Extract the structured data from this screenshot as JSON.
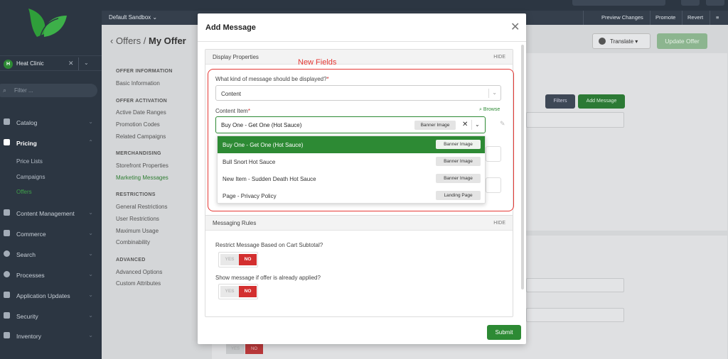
{
  "sidebar": {
    "tenant": {
      "badge": "H",
      "name": "Heat Clinic"
    },
    "filter_placeholder": "Filter ...",
    "nav": [
      {
        "label": "Catalog",
        "icon": "catalog-icon"
      },
      {
        "label": "Pricing",
        "icon": "pricing-icon"
      },
      {
        "label": "Content Management",
        "icon": "content-icon"
      },
      {
        "label": "Commerce",
        "icon": "cart-icon"
      },
      {
        "label": "Search",
        "icon": "search-icon"
      },
      {
        "label": "Processes",
        "icon": "processes-icon"
      },
      {
        "label": "Application Updates",
        "icon": "updates-icon"
      },
      {
        "label": "Security",
        "icon": "lock-icon"
      },
      {
        "label": "Inventory",
        "icon": "inventory-icon"
      }
    ],
    "pricing_sub": [
      "Price Lists",
      "Campaigns",
      "Offers"
    ]
  },
  "topbar": {
    "sandbox": "Default Sandbox",
    "preview": "Preview Changes",
    "promote": "Promote",
    "revert": "Revert"
  },
  "page": {
    "crumb_parent": "Offers",
    "crumb_current": "My Offer",
    "translate": "Translate",
    "update": "Update Offer",
    "filters": "Filters",
    "add_message": "Add Message"
  },
  "left_menu": {
    "offer_information": {
      "head": "OFFER INFORMATION",
      "items": [
        "Basic Information"
      ]
    },
    "offer_activation": {
      "head": "OFFER ACTIVATION",
      "items": [
        "Active Date Ranges",
        "Promotion Codes",
        "Related Campaigns"
      ]
    },
    "merchandising": {
      "head": "MERCHANDISING",
      "items": [
        "Storefront Properties",
        "Marketing Messages"
      ]
    },
    "restrictions": {
      "head": "RESTRICTIONS",
      "items": [
        "General Restrictions",
        "User Restrictions",
        "Maximum Usage",
        "Combinability"
      ]
    },
    "advanced": {
      "head": "ADVANCED",
      "items": [
        "Advanced Options",
        "Custom Attributes"
      ]
    }
  },
  "modal": {
    "title": "Add Message",
    "annotation": "New Fields",
    "display_section": {
      "title": "Display Properties",
      "hide": "HIDE"
    },
    "message_kind": {
      "label": "What kind of message should be displayed?",
      "required": "*",
      "value": "Content"
    },
    "content_item": {
      "label": "Content Item",
      "required": "*",
      "browse": "Browse",
      "value": "Buy One - Get One (Hot Sauce)",
      "value_tag": "Banner Image"
    },
    "options": [
      {
        "label": "Buy One - Get One (Hot Sauce)",
        "tag": "Banner Image"
      },
      {
        "label": "Bull Snort Hot Sauce",
        "tag": "Banner Image"
      },
      {
        "label": "New Item - Sudden Death Hot Sauce",
        "tag": "Banner Image"
      },
      {
        "label": "Page - Privacy Policy",
        "tag": "Landing Page"
      }
    ],
    "rules_section": {
      "title": "Messaging Rules",
      "hide": "HIDE"
    },
    "rule_cart": {
      "label": "Restrict Message Based on Cart Subtotal?",
      "yes": "YES",
      "no": "NO"
    },
    "rule_applied": {
      "label": "Show message if offer is already applied?",
      "yes": "YES",
      "no": "NO"
    },
    "submit": "Submit"
  },
  "ghost": {
    "yes": "YES",
    "no": "NO"
  },
  "colors": {
    "brand_green": "#2d8a34",
    "annotation_red": "#e53935",
    "sidebar": "#2c3642"
  }
}
